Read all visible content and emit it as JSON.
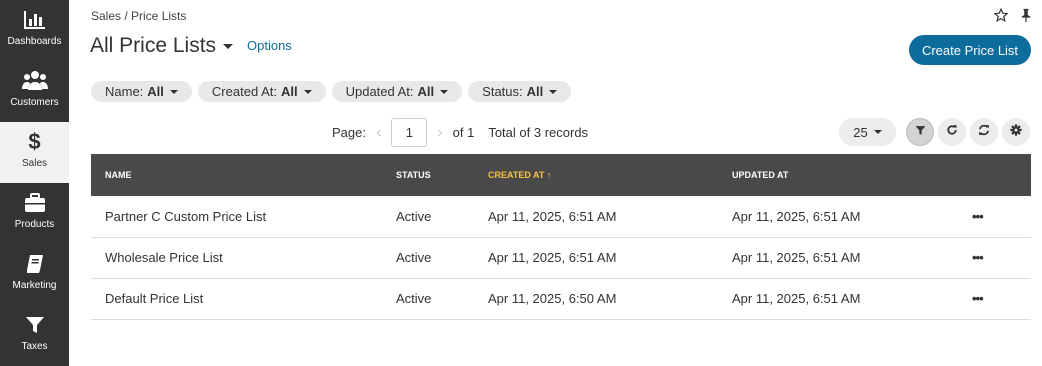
{
  "sidebar": {
    "items": [
      {
        "label": "Dashboards",
        "icon": "bar-chart-icon"
      },
      {
        "label": "Customers",
        "icon": "users-icon"
      },
      {
        "label": "Sales",
        "icon": "dollar-icon",
        "active": true
      },
      {
        "label": "Products",
        "icon": "briefcase-icon"
      },
      {
        "label": "Marketing",
        "icon": "book-icon"
      },
      {
        "label": "Taxes",
        "icon": "funnel-icon"
      }
    ]
  },
  "header": {
    "breadcrumb": "Sales / Price Lists",
    "title": "All Price Lists",
    "options_label": "Options",
    "create_label": "Create Price List"
  },
  "filters": [
    {
      "name": "Name:",
      "value": "All"
    },
    {
      "name": "Created At:",
      "value": "All"
    },
    {
      "name": "Updated At:",
      "value": "All"
    },
    {
      "name": "Status:",
      "value": "All"
    }
  ],
  "pager": {
    "page_label": "Page:",
    "current_page": "1",
    "of_label": "of 1",
    "total": "Total of 3 records",
    "per_page": "25"
  },
  "table": {
    "columns": [
      "NAME",
      "STATUS",
      "CREATED AT",
      "UPDATED AT"
    ],
    "sorted_indicator": "↑",
    "rows": [
      {
        "name": "Partner C Custom Price List",
        "status": "Active",
        "created": "Apr 11, 2025, 6:51 AM",
        "updated": "Apr 11, 2025, 6:51 AM",
        "actions": "•••"
      },
      {
        "name": "Wholesale Price List",
        "status": "Active",
        "created": "Apr 11, 2025, 6:51 AM",
        "updated": "Apr 11, 2025, 6:51 AM",
        "actions": "•••"
      },
      {
        "name": "Default Price List",
        "status": "Active",
        "created": "Apr 11, 2025, 6:50 AM",
        "updated": "Apr 11, 2025, 6:51 AM",
        "actions": "•••"
      }
    ]
  },
  "colors": {
    "sidebar_bg": "#333333",
    "accent": "#0c6c9b",
    "table_header_bg": "#494949",
    "sorted_header": "#f6c342"
  }
}
